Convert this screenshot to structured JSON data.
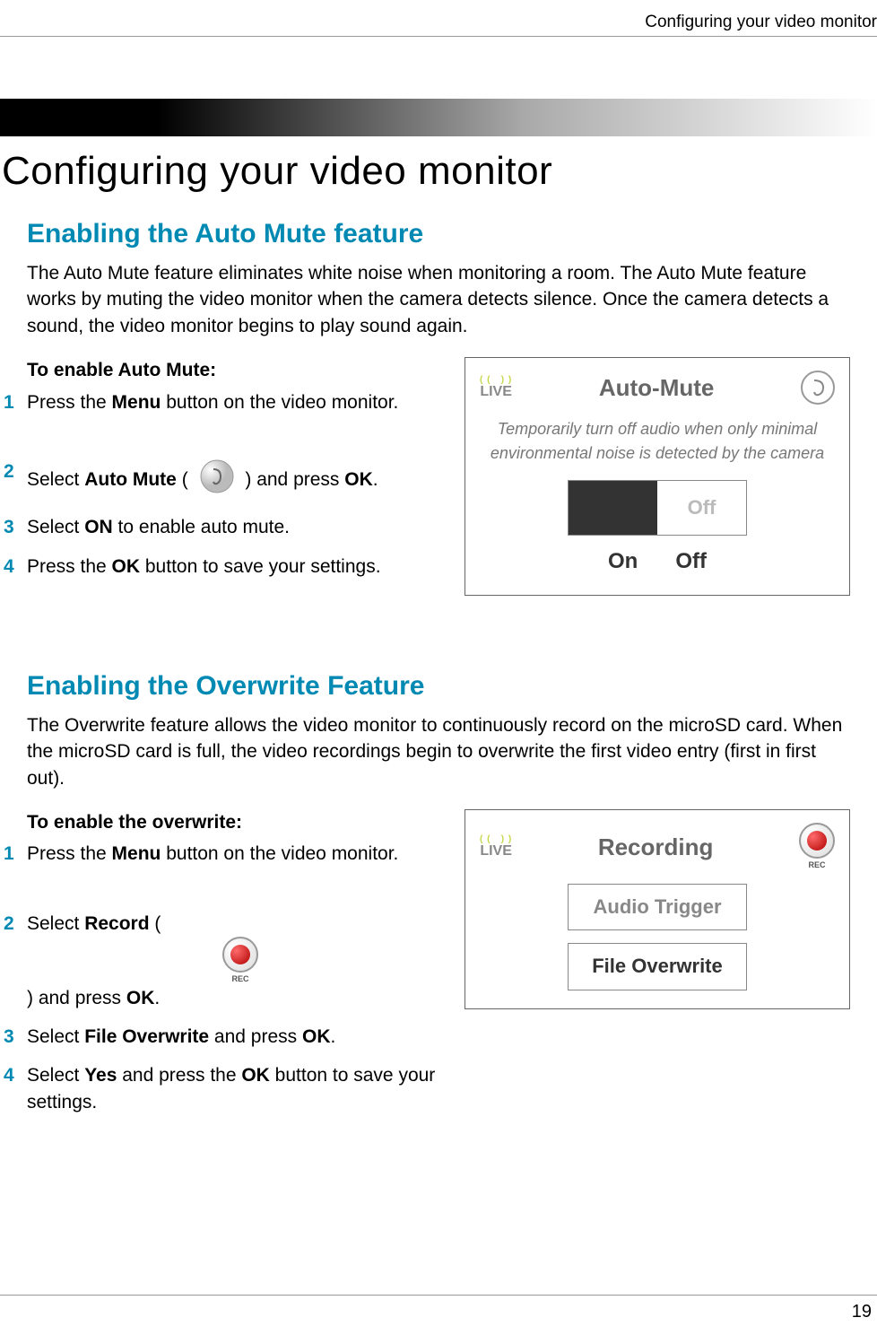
{
  "header": {
    "right_title": "Configuring your video monitor"
  },
  "page_title": "Configuring your video monitor",
  "section1": {
    "title": "Enabling the Auto Mute feature",
    "desc": "The Auto Mute feature eliminates white noise when monitoring a room. The Auto Mute feature works by muting the video monitor when the camera detects silence. Once the camera detects a sound, the video monitor begins to play sound again.",
    "sub": "To enable Auto Mute:",
    "steps": {
      "n1": "1",
      "s1a": "Press the ",
      "s1b": "Menu",
      "s1c": " button on the video monitor.",
      "n2": "2",
      "s2a": "Select ",
      "s2b": "Auto Mute",
      "s2c": " ( ",
      "s2d": " ) and press ",
      "s2e": "OK",
      "s2f": ".",
      "n3": "3",
      "s3a": "Select ",
      "s3b": "ON",
      "s3c": " to enable auto mute.",
      "n4": "4",
      "s4a": "Press the ",
      "s4b": "OK",
      "s4c": " button to save your settings."
    },
    "fig": {
      "live": "LIVE",
      "title": "Auto-Mute",
      "desc": "Temporarily turn off audio when only minimal environmental noise is detected by the camera",
      "off_in_box": "Off",
      "on_label": "On",
      "off_label": "Off"
    }
  },
  "section2": {
    "title": "Enabling the Overwrite Feature",
    "desc": "The Overwrite feature allows the video monitor to continuously record on the microSD card. When the microSD card is full, the video recordings begin to overwrite the first video entry (first in first out).",
    "sub": "To enable the overwrite:",
    "steps": {
      "n1": "1",
      "s1a": "Press the ",
      "s1b": "Menu",
      "s1c": " button on the video monitor.",
      "n2": "2",
      "s2a": "Select ",
      "s2b": "Record",
      "s2c": " ( ",
      "s2d": " ) and press ",
      "s2e": "OK",
      "s2f": ".",
      "n3": "3",
      "s3a": "Select ",
      "s3b": "File Overwrite",
      "s3c": " and press ",
      "s3d": "OK",
      "s3e": ".",
      "n4": "4",
      "s4a": "Select ",
      "s4b": "Yes",
      "s4c": " and press the ",
      "s4d": "OK",
      "s4e": " button to save your settings."
    },
    "fig": {
      "live": "LIVE",
      "title": "Recording",
      "rec_label": "REC",
      "opt1": "Audio Trigger",
      "opt2": "File Overwrite"
    }
  },
  "page_number": "19"
}
